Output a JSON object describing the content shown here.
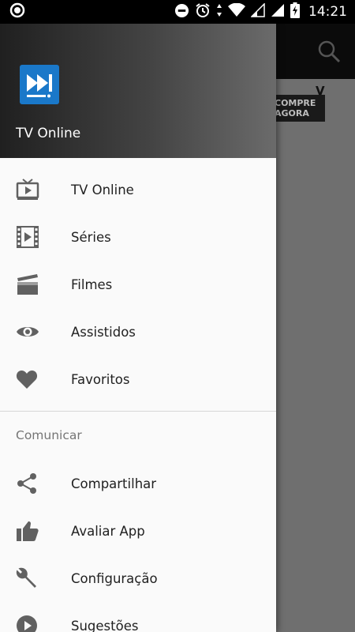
{
  "status_bar": {
    "time": "14:21"
  },
  "drawer": {
    "app_name": "TV Online",
    "primary_items": [
      {
        "label": "TV Online",
        "icon": "tv-icon"
      },
      {
        "label": "Séries",
        "icon": "film-icon"
      },
      {
        "label": "Filmes",
        "icon": "clapperboard-icon"
      },
      {
        "label": "Assistidos",
        "icon": "eye-icon"
      },
      {
        "label": "Favoritos",
        "icon": "heart-icon"
      }
    ],
    "section_title": "Comunicar",
    "secondary_items": [
      {
        "label": "Compartilhar",
        "icon": "share-icon"
      },
      {
        "label": "Avaliar App",
        "icon": "thumbs-up-icon"
      },
      {
        "label": "Configuração",
        "icon": "wrench-icon"
      },
      {
        "label": "Sugestões",
        "icon": "play-circle-icon"
      }
    ]
  },
  "background": {
    "ad_line1": "COMPRE",
    "ad_line2": "AGORA",
    "ad_badge": "V"
  },
  "colors": {
    "accent": "#1a78c9",
    "icon_gray": "#616161",
    "text": "#212121"
  }
}
